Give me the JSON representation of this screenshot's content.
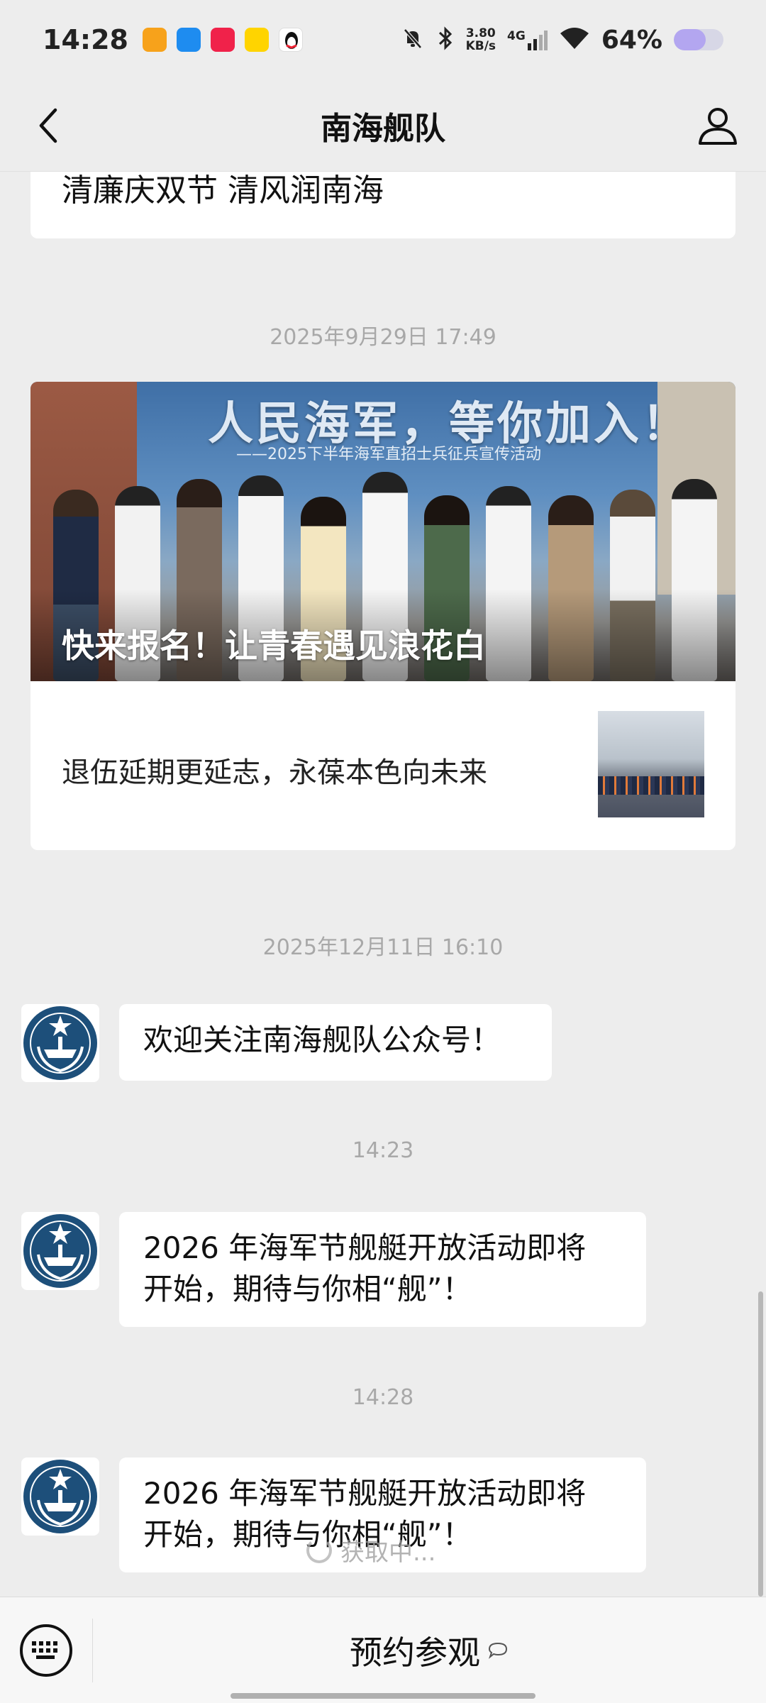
{
  "status_bar": {
    "time": "14:28",
    "net_speed_value": "3.80",
    "net_speed_unit": "KB/s",
    "network": "4G",
    "battery_percent": "64%",
    "battery_level": 0.64,
    "icons": [
      "app-orange-icon",
      "app-blue-icon",
      "app-red-icon",
      "app-yellow-icon",
      "qq-penguin-icon",
      "mute-bell-icon",
      "bluetooth-icon",
      "signal-icon",
      "wifi-icon",
      "battery-icon"
    ]
  },
  "header": {
    "title": "南海舰队",
    "back_icon": "chevron-left-icon",
    "profile_icon": "user-icon"
  },
  "feed": {
    "top_card_title": "清廉庆双节 清风润南海",
    "timestamp_1": "2025年9月29日 17:49",
    "article": {
      "banner_title": "人民海军，等你加入！",
      "banner_subtitle": "——2025下半年海军直招士兵征兵宣传活动",
      "hero_caption": "快来报名！让青春遇见浪花白",
      "sub_title": "退伍延期更延志，永葆本色向未来"
    },
    "timestamp_2": "2025年12月11日 16:10",
    "message_1": "欢迎关注南海舰队公众号！",
    "timestamp_3": "14:23",
    "message_2_line1": "2026 年海军节舰艇开放活动即将",
    "message_2_line2": "开始，期待与你相“舰”！",
    "timestamp_4": "14:28",
    "message_3_line1": "2026 年海军节舰艇开放活动即将",
    "message_3_line2": "开始，期待与你相“舰”！",
    "loading_text": "获取中..."
  },
  "bottom_bar": {
    "menu_label": "预约参观",
    "keyboard_icon": "keyboard-icon",
    "menu_icon": "chat-bubble-icon"
  },
  "colors": {
    "background": "#ededed",
    "card": "#ffffff",
    "timestamp": "#a8a8a8",
    "emblem_blue": "#1d4f7a"
  }
}
